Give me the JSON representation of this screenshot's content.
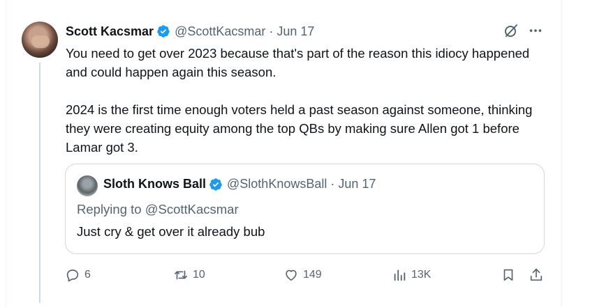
{
  "tweet": {
    "author_name": "Scott Kacsmar",
    "handle": "@ScottKacsmar",
    "separator": "·",
    "date": "Jun 17",
    "paragraphs": [
      "You need to get over 2023 because that's part of the reason this idiocy happened and could happen again this season.",
      "2024 is the first time enough voters held a past season against someone, thinking they were creating equity among the top QBs by making sure Allen got 1 before Lamar got 3."
    ]
  },
  "quoted_tweet": {
    "author_name": "Sloth Knows Ball",
    "handle": "@SlothKnowsBall",
    "separator": "·",
    "date": "Jun 17",
    "replying_to": "Replying to @ScottKacsmar",
    "text": "Just cry & get over it already bub"
  },
  "actions": {
    "replies": "6",
    "retweets": "10",
    "likes": "149",
    "views": "13K"
  },
  "colors": {
    "verified_blue": "#1d9bf0",
    "secondary_text": "#536471",
    "border": "#cfd9de"
  },
  "icons": [
    "grok-icon",
    "more-icon",
    "verified-badge-icon",
    "reply-icon",
    "retweet-icon",
    "like-icon",
    "views-icon",
    "bookmark-icon",
    "share-icon"
  ]
}
